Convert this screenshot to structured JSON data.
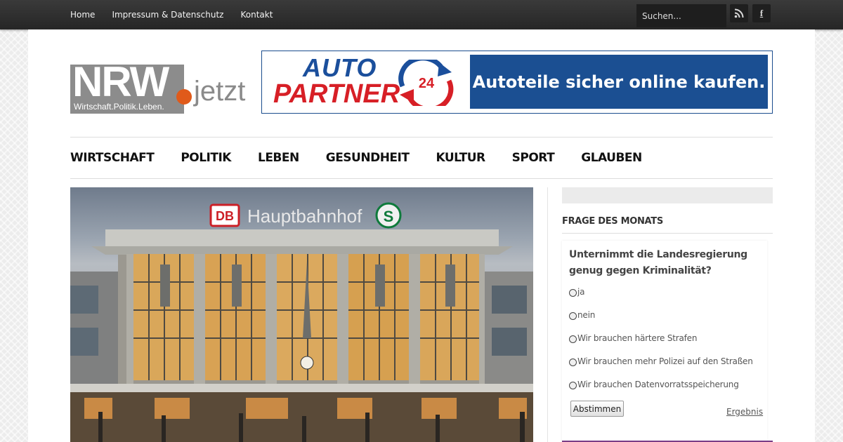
{
  "topbar": {
    "nav": [
      "Home",
      "Impressum & Datenschutz",
      "Kontakt"
    ],
    "search_placeholder": "Suchen...",
    "social": [
      "rss-icon",
      "facebook-icon"
    ],
    "facebook_glyph": "f"
  },
  "logo": {
    "main": "NRW",
    "suffix": "jetzt",
    "tagline": "Wirtschaft.Politik.Leben."
  },
  "ad": {
    "brand_top": "AUTO",
    "brand_bottom": "PARTNER",
    "badge": "24",
    "slogan": "Autoteile sicher online kaufen.",
    "colors": {
      "blue": "#1b4f92",
      "red": "#d71f26"
    }
  },
  "main_nav": [
    "WIRTSCHAFT",
    "POLITIK",
    "LEBEN",
    "GESUNDHEIT",
    "KULTUR",
    "SPORT",
    "GLAUBEN"
  ],
  "hero": {
    "station_sign": "Hauptbahnhof",
    "db_logo": "DB",
    "sbahn_logo": "S"
  },
  "sidebar": {
    "poll_title": "FRAGE DES MONATS",
    "question": "Unternimmt die Landesregierung genug gegen Kriminalität?",
    "options": [
      "ja",
      "nein",
      "Wir brauchen härtere Strafen",
      "Wir brauchen mehr Polizei auf den Straßen",
      "Wir brauchen Datenvorratsspeicherung"
    ],
    "vote_label": "Abstimmen",
    "result_label": "Ergebnis",
    "accent": "#7a3d86"
  }
}
